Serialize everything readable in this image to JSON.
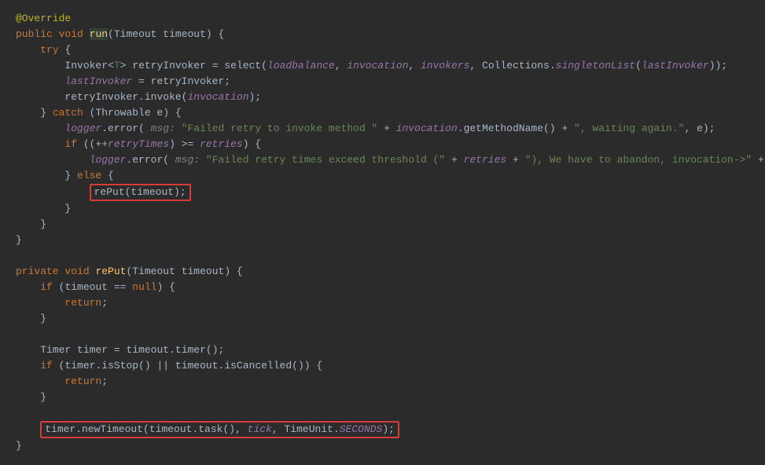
{
  "code": {
    "override": "@Override",
    "kw_public": "public",
    "kw_void": "void",
    "kw_private": "private",
    "kw_try": "try",
    "kw_catch": "catch",
    "kw_if": "if",
    "kw_else": "else",
    "kw_return": "return",
    "kw_null": "null",
    "run": "run",
    "rePut_def": "rePut",
    "Timeout": "Timeout",
    "timeout": "timeout",
    "Invoker": "Invoker",
    "T": "T",
    "retryInvoker": "retryInvoker",
    "select": "select",
    "loadbalance": "loadbalance",
    "invocation": "invocation",
    "invokers": "invokers",
    "Collections": "Collections",
    "singletonList": "singletonList",
    "lastInvoker": "lastInvoker",
    "invoke": "invoke",
    "Throwable": "Throwable",
    "e": "e",
    "logger": "logger",
    "error": "error",
    "msg_label": "msg:",
    "str_failed_retry": "\"Failed retry to invoke method \"",
    "getMethodName": "getMethodName",
    "str_waiting": "\", waiting again.\"",
    "retryTimes": "retryTimes",
    "retries": "retries",
    "str_exceed": "\"Failed retry times exceed threshold (\"",
    "str_abandon": "\"), We have to abandon, invocation->\"",
    "rePut_call": "rePut(timeout);",
    "Timer": "Timer",
    "timer_var": "timer",
    "timer_call": "timer",
    "isStop": "isStop",
    "isCancelled": "isCancelled",
    "newTimeout_line_pre": "timer.newTimeout(timeout.task(), ",
    "tick": "tick",
    "TimeUnit": "TimeUnit",
    "SECONDS": "SECONDS",
    "newTimeout_line_post": ");"
  }
}
